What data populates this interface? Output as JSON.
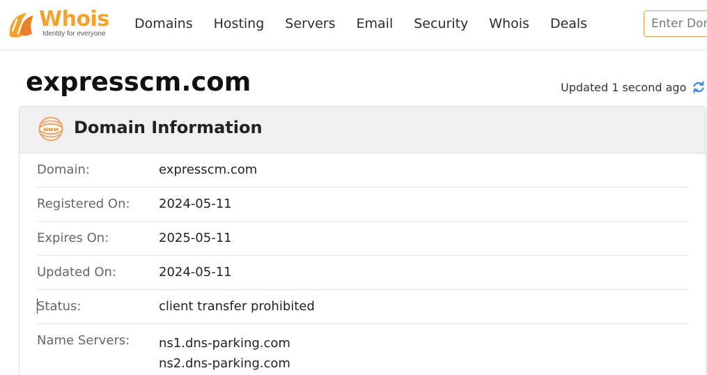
{
  "brand": {
    "name": "Whois",
    "tagline": "Identity for everyone",
    "accent": "#f5a12a",
    "accent_dark": "#e8802a"
  },
  "nav": {
    "items": [
      {
        "label": "Domains"
      },
      {
        "label": "Hosting"
      },
      {
        "label": "Servers"
      },
      {
        "label": "Email"
      },
      {
        "label": "Security"
      },
      {
        "label": "Whois"
      },
      {
        "label": "Deals"
      }
    ]
  },
  "search": {
    "placeholder": "Enter Domain"
  },
  "page": {
    "domain": "expresscm.com",
    "updated": "Updated 1 second ago",
    "refresh_icon": "refresh-icon"
  },
  "domain_info": {
    "title": "Domain Information",
    "icon": "www-icon",
    "rows": [
      {
        "label": "Domain:",
        "value": "expresscm.com"
      },
      {
        "label": "Registered On:",
        "value": "2024-05-11"
      },
      {
        "label": "Expires On:",
        "value": "2025-05-11"
      },
      {
        "label": "Updated On:",
        "value": "2024-05-11"
      },
      {
        "label": "Status:",
        "value": "client transfer prohibited"
      },
      {
        "label": "Name Servers:",
        "values": [
          "ns1.dns-parking.com",
          "ns2.dns-parking.com"
        ]
      }
    ]
  }
}
